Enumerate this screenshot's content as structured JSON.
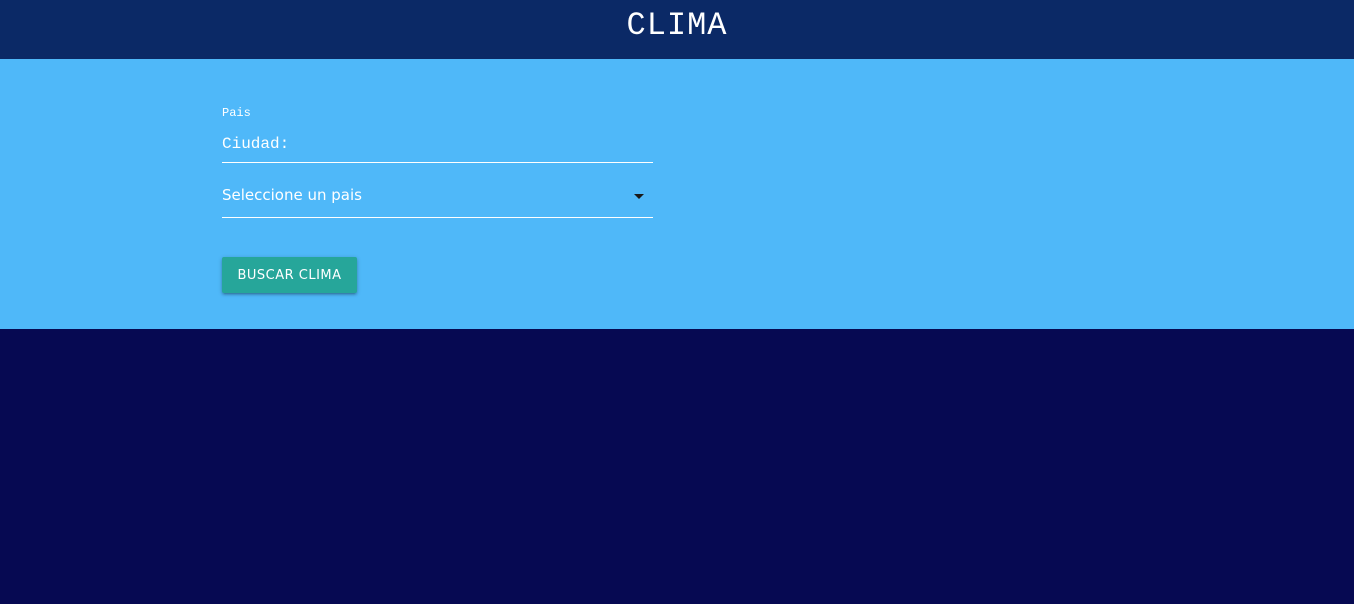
{
  "header": {
    "title": "CLIMA"
  },
  "form": {
    "country_label": "Pais",
    "city_placeholder": "Ciudad:",
    "city_value": "",
    "country_select": {
      "selected": "Seleccione un pais"
    },
    "submit_label": "BUSCAR CLIMA"
  },
  "colors": {
    "header_bg": "#0b2966",
    "panel_bg": "#4fb8f9",
    "page_bg": "#060952",
    "button_bg": "#26a69a"
  },
  "icons": {
    "select_caret": "caret-down-icon"
  }
}
